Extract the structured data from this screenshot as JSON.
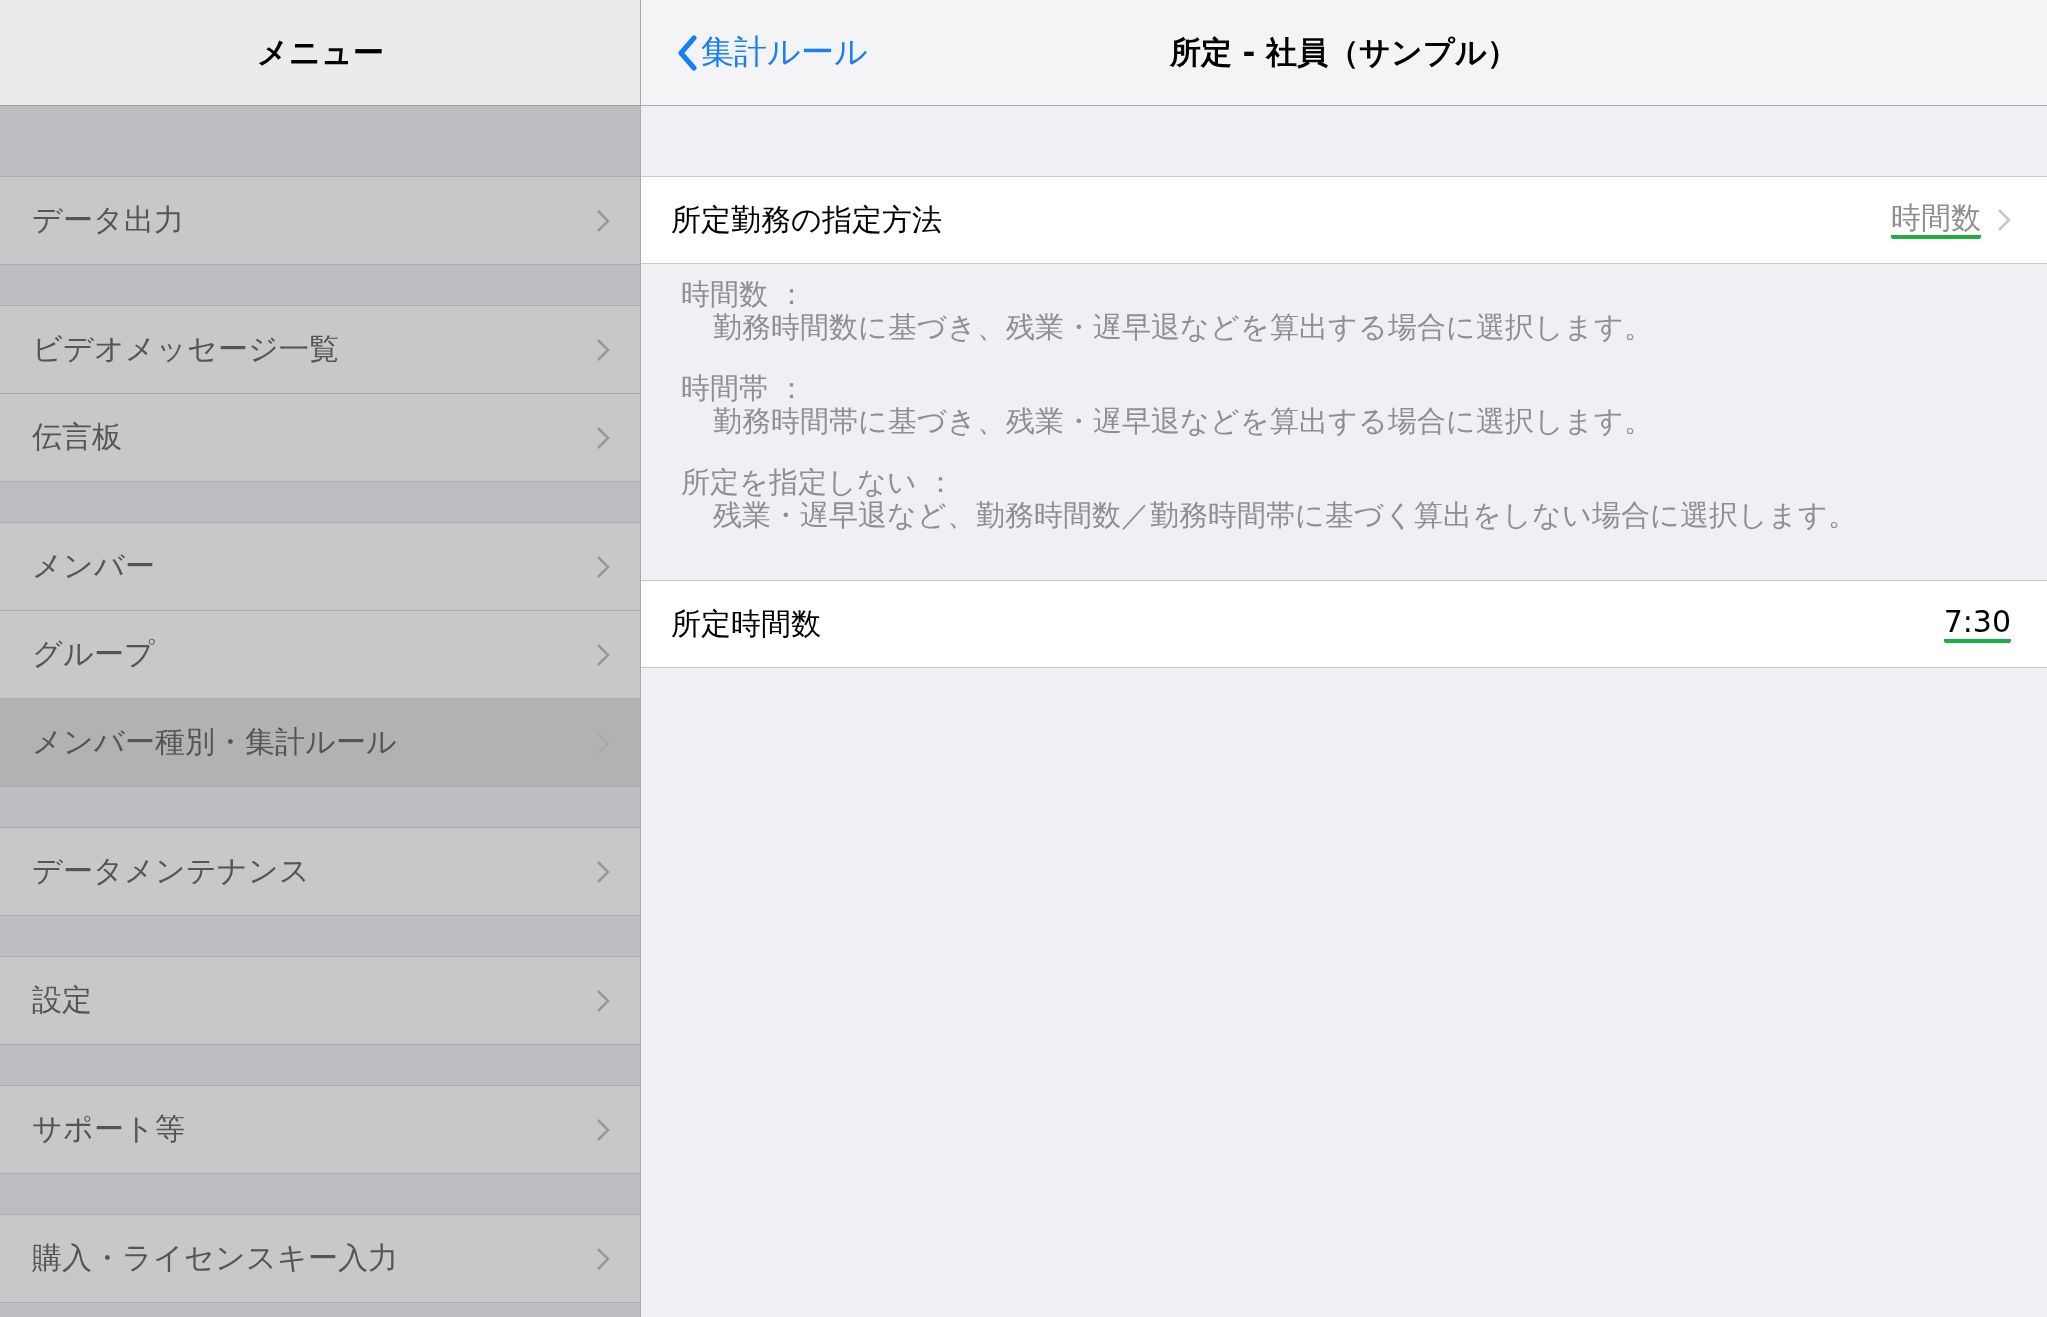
{
  "sidebar": {
    "title": "メニュー",
    "groups": [
      {
        "items": [
          {
            "label": "データ出力",
            "selected": false
          }
        ]
      },
      {
        "items": [
          {
            "label": "ビデオメッセージ一覧",
            "selected": false
          },
          {
            "label": "伝言板",
            "selected": false
          }
        ]
      },
      {
        "items": [
          {
            "label": "メンバー",
            "selected": false
          },
          {
            "label": "グループ",
            "selected": false
          },
          {
            "label": "メンバー種別・集計ルール",
            "selected": true
          }
        ]
      },
      {
        "items": [
          {
            "label": "データメンテナンス",
            "selected": false
          }
        ]
      },
      {
        "items": [
          {
            "label": "設定",
            "selected": false
          }
        ]
      },
      {
        "items": [
          {
            "label": "サポート等",
            "selected": false
          }
        ]
      },
      {
        "items": [
          {
            "label": "購入・ライセンスキー入力",
            "selected": false
          }
        ]
      }
    ]
  },
  "detail": {
    "back": "集計ルール",
    "title": "所定 - 社員（サンプル）",
    "method_row": {
      "label": "所定勤務の指定方法",
      "value": "時間数",
      "underlined": true
    },
    "notes": [
      {
        "term": "時間数 ：",
        "text": "勤務時間数に基づき、残業・遅早退などを算出する場合に選択します。"
      },
      {
        "term": "時間帯 ：",
        "text": "勤務時間帯に基づき、残業・遅早退などを算出する場合に選択します。"
      },
      {
        "term": "所定を指定しない ：",
        "text": "残業・遅早退など、勤務時間数／勤務時間帯に基づく算出をしない場合に選択します。"
      }
    ],
    "hours_row": {
      "label": "所定時間数",
      "value": "7:30",
      "underlined": true
    }
  }
}
